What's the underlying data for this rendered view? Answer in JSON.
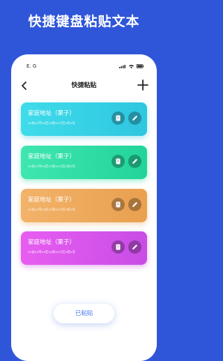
{
  "promo": {
    "headline": "快捷键盘粘贴文本"
  },
  "status_bar": {
    "carrier": "E. G"
  },
  "nav": {
    "title": "快捷粘贴"
  },
  "cards": [
    {
      "title": "家庭地址（栗子）",
      "subtitle": "xx省xx市xx区xx街xx小区x栋x号",
      "color_start": "#3fdcea",
      "color_end": "#2fc6e0"
    },
    {
      "title": "家庭地址（栗子）",
      "subtitle": "xx省xx市xx区xx街xx小区x栋x号",
      "color_start": "#3fe6b0",
      "color_end": "#22d49a"
    },
    {
      "title": "家庭地址（栗子）",
      "subtitle": "xx省xx市xx区xx街xx小区x栋x号",
      "color_start": "#f2b36a",
      "color_end": "#e9a04f"
    },
    {
      "title": "家庭地址（栗子）",
      "subtitle": "xx省xx市xx区xx街xx小区x栋x号",
      "color_start": "#e85df0",
      "color_end": "#c74ee6"
    }
  ],
  "footer": {
    "pasted_label": "已粘贴"
  },
  "colors": {
    "background": "#2f56d9",
    "accent": "#4a7cf0"
  }
}
